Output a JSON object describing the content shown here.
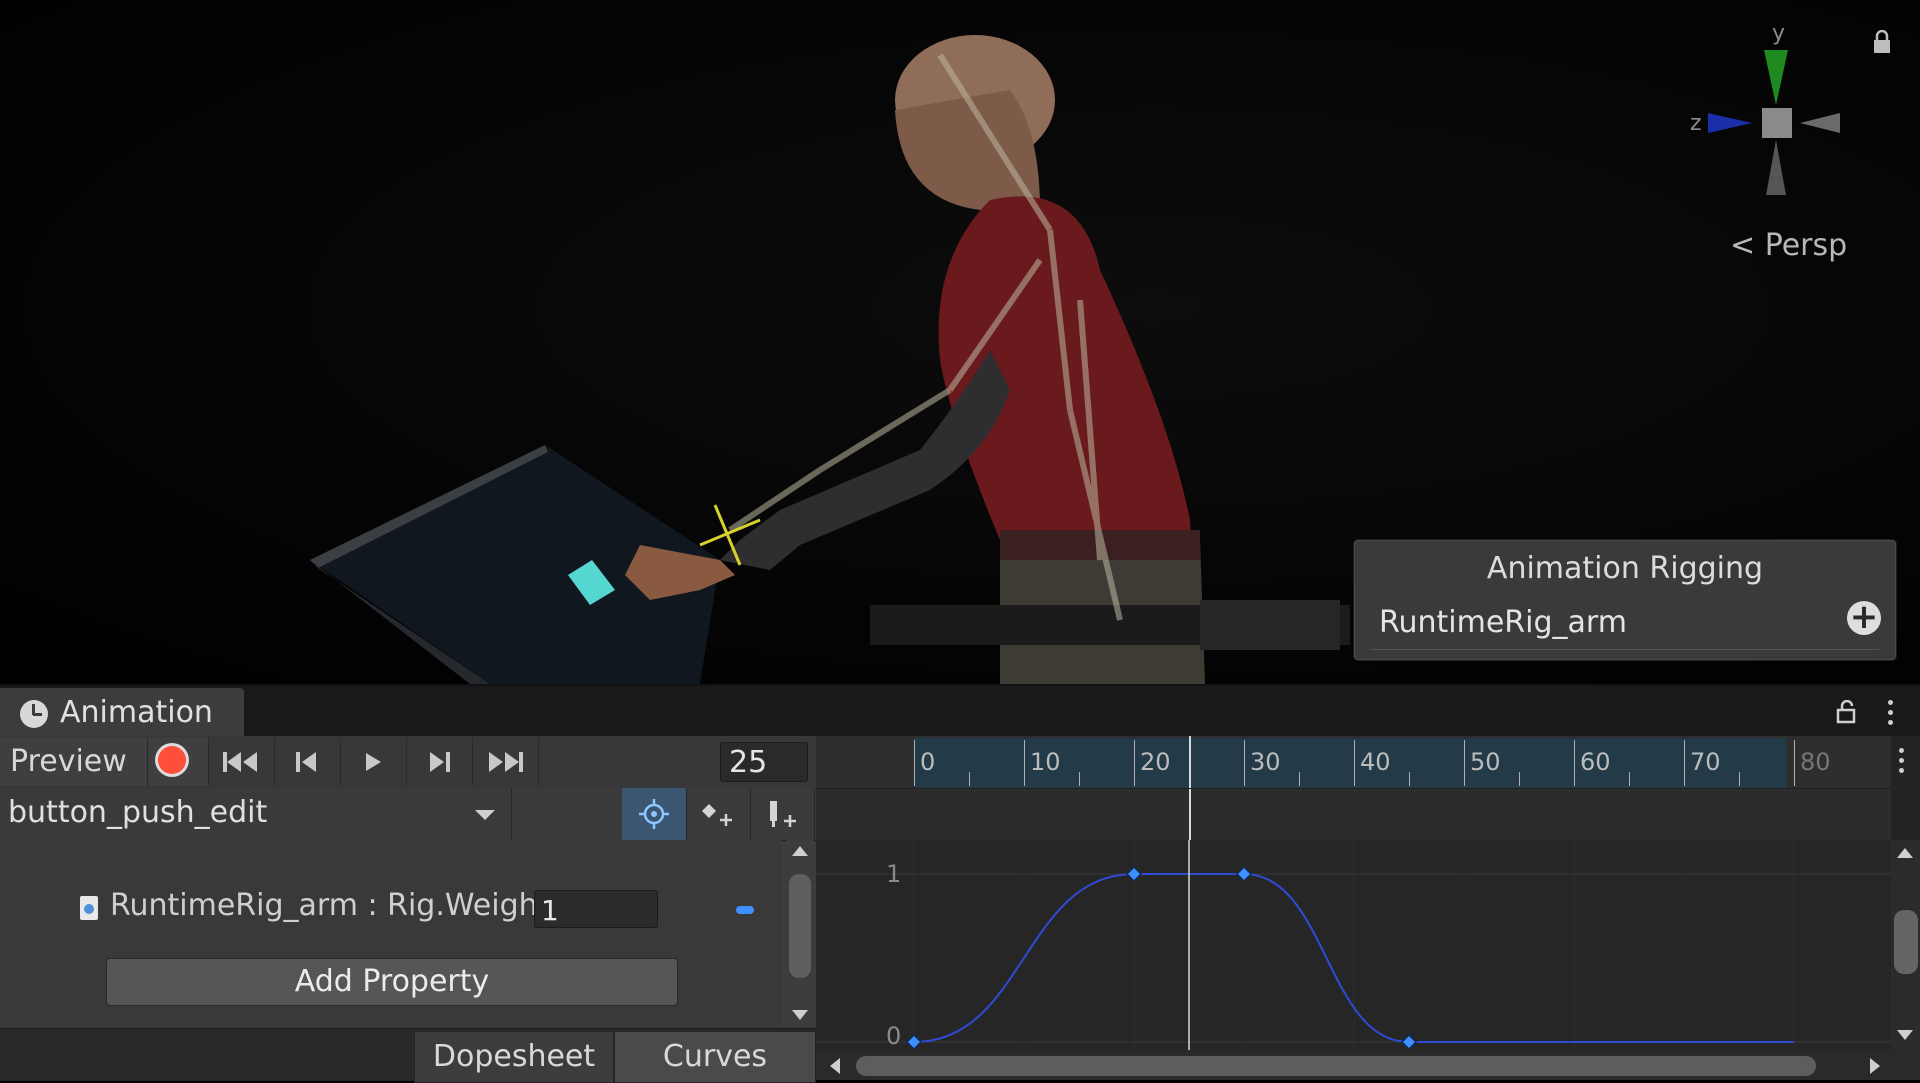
{
  "scene": {
    "gizmo_axes": {
      "y": "y",
      "z": "z"
    },
    "projection_label": "Persp",
    "overlay": {
      "title": "Animation Rigging",
      "rig_item": "RuntimeRig_arm"
    }
  },
  "window": {
    "tab_label": "Animation"
  },
  "controls": {
    "preview_label": "Preview",
    "current_frame": "25"
  },
  "clip": {
    "name": "button_push_edit"
  },
  "property": {
    "label": "RuntimeRig_arm : Rig.Weight",
    "value": "1"
  },
  "add_property_label": "Add Property",
  "bottom_tabs": [
    "Dopesheet",
    "Curves"
  ],
  "timeline": {
    "tick_labels": [
      "0",
      "10",
      "20",
      "30",
      "40",
      "50",
      "60",
      "70",
      "80"
    ]
  },
  "curve_axis": {
    "y_labels": [
      "1",
      "0"
    ]
  },
  "chart_data": {
    "type": "line",
    "series": [
      {
        "x": [
          0,
          20,
          30,
          45,
          80
        ],
        "y": [
          0,
          1,
          1,
          0,
          0
        ]
      }
    ],
    "current_frame": 25,
    "xlim": [
      0,
      80
    ],
    "ylim": [
      0,
      1
    ],
    "curve_color": "#2f4bd6",
    "key_color": "#3f8fff"
  },
  "colors": {
    "record": "#ff4e3a",
    "timeline_active": "#233a48",
    "panel": "#3c3c3c"
  }
}
